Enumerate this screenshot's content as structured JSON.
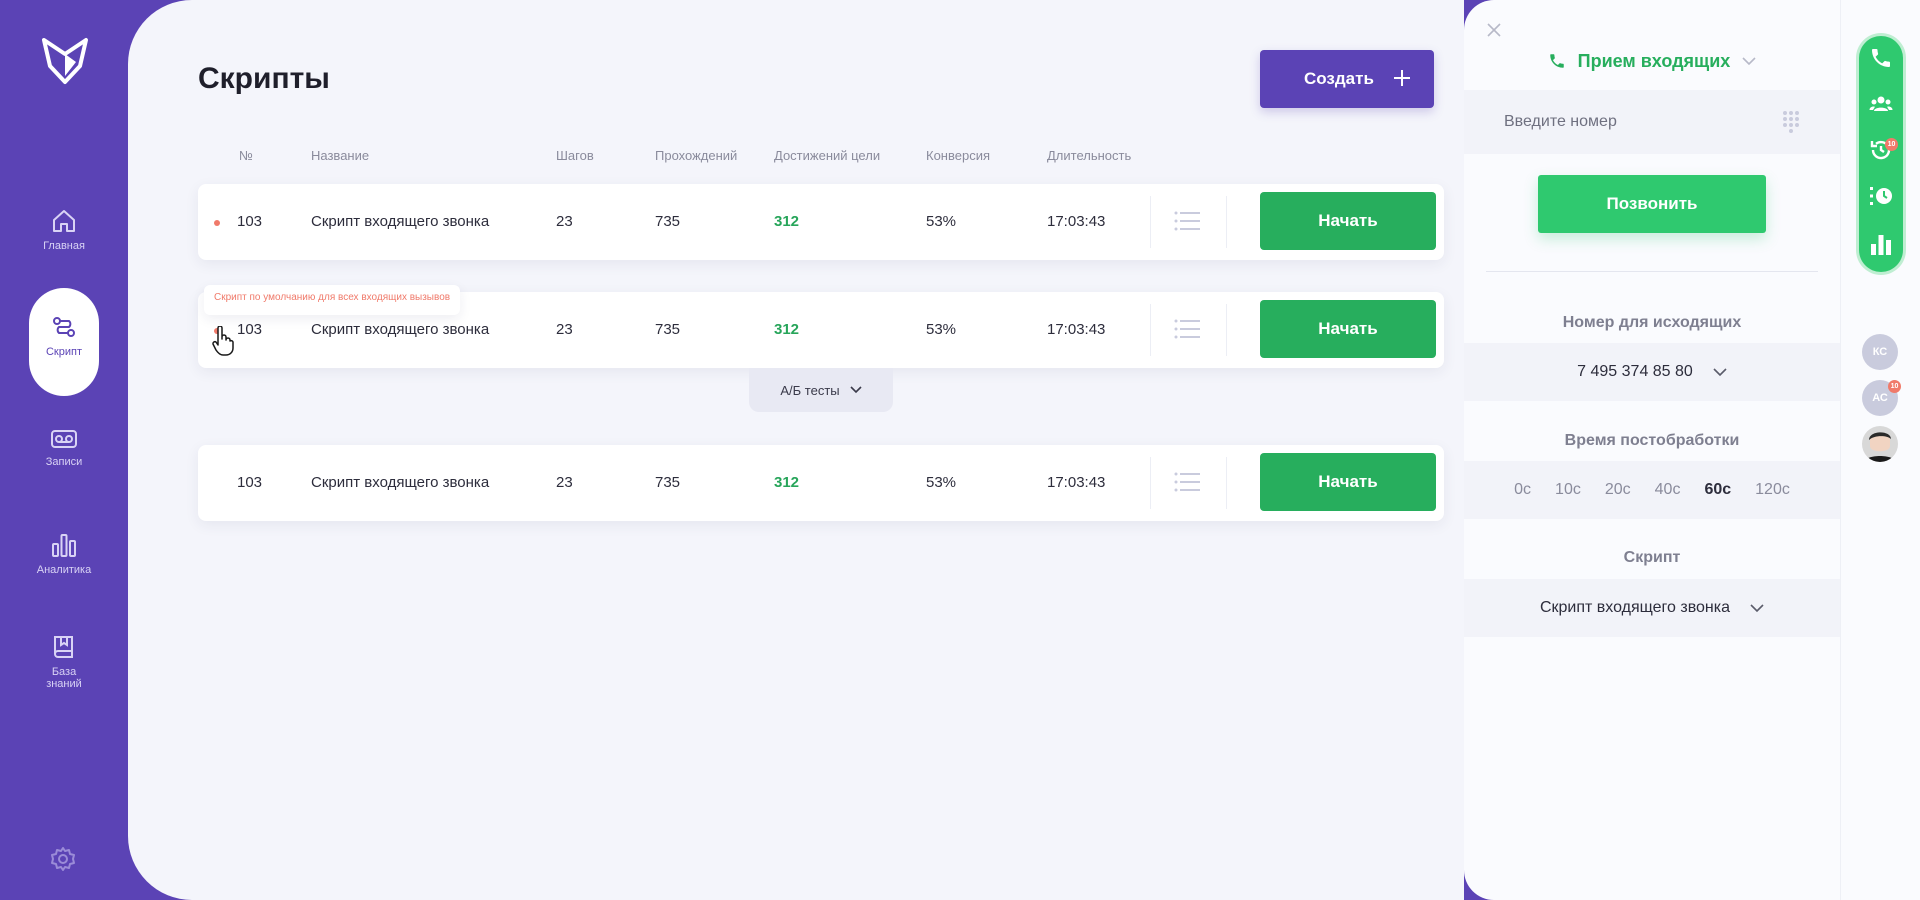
{
  "sidebar": {
    "items": [
      {
        "label": "Главная",
        "icon": "home-icon"
      },
      {
        "label": "Скрипт",
        "icon": "script-icon"
      },
      {
        "label": "Записи",
        "icon": "recording-icon"
      },
      {
        "label": "Аналитика",
        "icon": "analytics-icon"
      },
      {
        "label": "База знаний",
        "label_line1": "База",
        "label_line2": "знаний",
        "icon": "book-icon"
      }
    ]
  },
  "header": {
    "title": "Скрипты",
    "create_label": "Создать"
  },
  "table": {
    "columns": [
      "№",
      "Название",
      "Шагов",
      "Прохождений",
      "Достижений цели",
      "Конверсия",
      "Длительность"
    ],
    "rows": [
      {
        "num": "103",
        "name": "Скрипт входящего звонка",
        "steps": "23",
        "passes": "735",
        "goals": "312",
        "conversion": "53%",
        "duration": "17:03:43",
        "action": "Начать"
      },
      {
        "num": "103",
        "name": "Скрипт входящего звонка",
        "steps": "23",
        "passes": "735",
        "goals": "312",
        "conversion": "53%",
        "duration": "17:03:43",
        "action": "Начать"
      },
      {
        "num": "103",
        "name": "Скрипт входящего звонка",
        "steps": "23",
        "passes": "735",
        "goals": "312",
        "conversion": "53%",
        "duration": "17:03:43",
        "action": "Начать"
      }
    ],
    "tooltip": "Скрипт по умолчанию для всех входящих вызывов",
    "ab_tab_label": "А/Б тесты"
  },
  "phone": {
    "mode": "Прием входящих",
    "number_placeholder": "Введите номер",
    "call_label": "Позвонить",
    "outgoing_label": "Номер для исходящих",
    "outgoing_number": "7 495 374 85 80",
    "wrapup_label": "Время постобработки",
    "wrapup_options": [
      "0с",
      "10с",
      "20с",
      "40с",
      "60с",
      "120с"
    ],
    "wrapup_selected": "60с",
    "script_label": "Скрипт",
    "script_value": "Скрипт входящего звонка"
  },
  "rail": {
    "history_badge": "10",
    "avatars": [
      {
        "initials": "КС"
      },
      {
        "initials": "АС",
        "badge": "10"
      }
    ]
  },
  "colors": {
    "brand": "#5b43b5",
    "success": "#27ae5d",
    "accent_red": "#f07a6a"
  }
}
